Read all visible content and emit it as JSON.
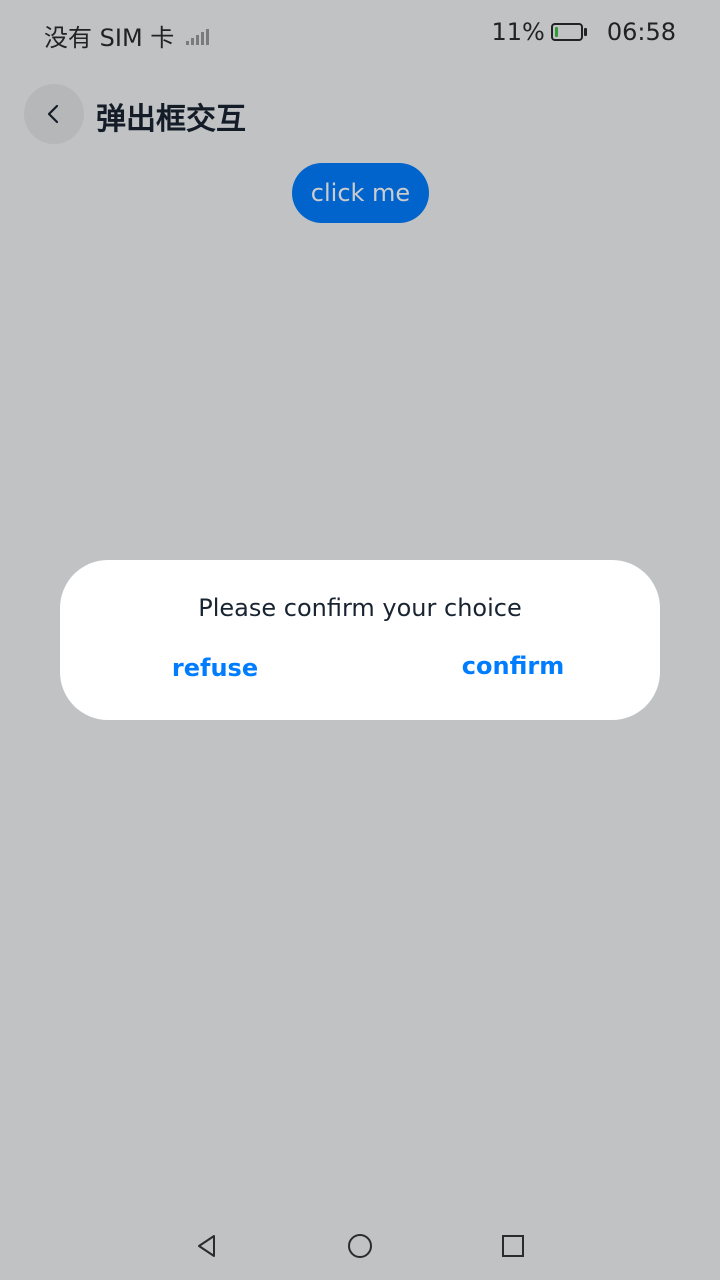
{
  "status_bar": {
    "carrier": "没有 SIM 卡",
    "battery_percent": "11%",
    "battery_level": 0.11,
    "time": "06:58",
    "icons": [
      "signal-icon",
      "battery-icon"
    ]
  },
  "app_bar": {
    "title": "弹出框交互",
    "back_icon": "chevron-left-icon"
  },
  "main": {
    "button_label": "click me"
  },
  "dialog": {
    "message": "Please confirm your choice",
    "refuse_label": "refuse",
    "confirm_label": "confirm"
  },
  "nav_bar": {
    "icons": [
      "triangle-back-icon",
      "circle-home-icon",
      "square-recent-icon"
    ]
  },
  "colors": {
    "accent": "#007dff",
    "background": "#f1f3f5",
    "title_text": "#182431",
    "battery_low": "#3cc24a"
  }
}
